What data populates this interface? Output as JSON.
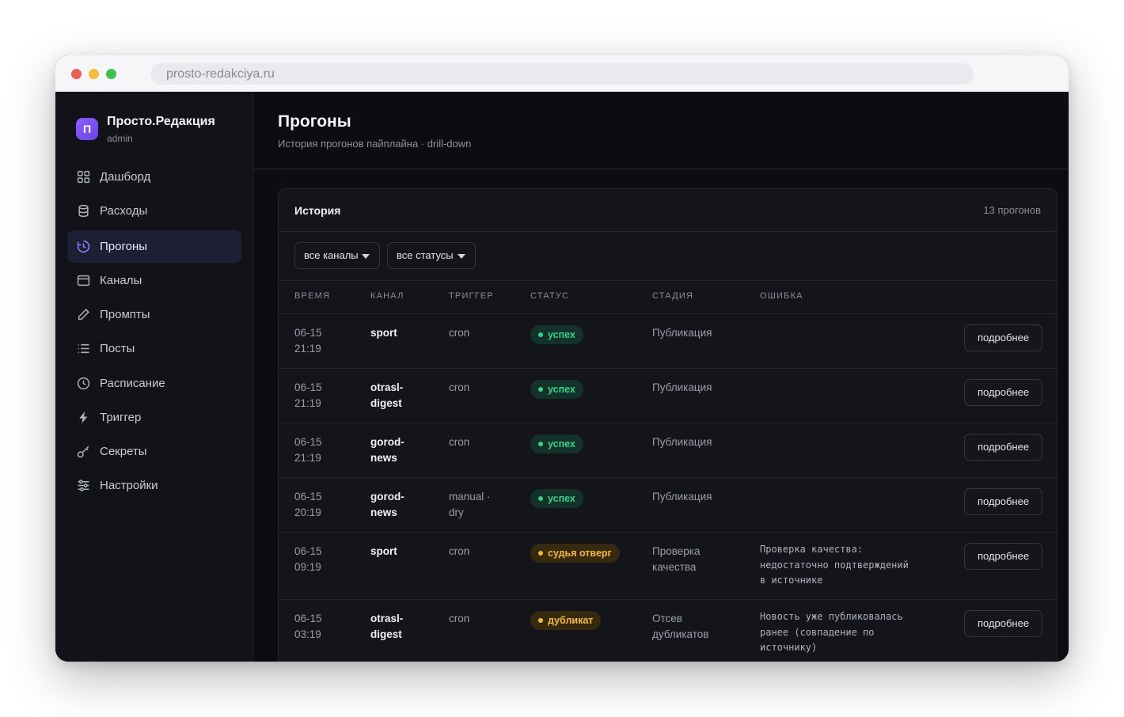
{
  "browser": {
    "url": "prosto-redakciya.ru"
  },
  "sidebar": {
    "brand_letter": "П",
    "brand_name": "Просто.Редакция",
    "brand_role": "admin",
    "items": [
      {
        "label": "Дашборд",
        "icon": "grid-icon"
      },
      {
        "label": "Расходы",
        "icon": "database-icon"
      },
      {
        "label": "Прогоны",
        "icon": "history-icon",
        "active": true
      },
      {
        "label": "Каналы",
        "icon": "window-icon"
      },
      {
        "label": "Промпты",
        "icon": "pencil-icon"
      },
      {
        "label": "Посты",
        "icon": "list-icon"
      },
      {
        "label": "Расписание",
        "icon": "clock-icon"
      },
      {
        "label": "Триггер",
        "icon": "lightning-icon"
      },
      {
        "label": "Секреты",
        "icon": "key-icon"
      },
      {
        "label": "Настройки",
        "icon": "sliders-icon"
      }
    ]
  },
  "header": {
    "title": "Прогоны",
    "subtitle": "История прогонов пайплайна · drill-down"
  },
  "card": {
    "title": "История",
    "count": "13 прогонов",
    "filters": {
      "channels": "все каналы",
      "statuses": "все статусы"
    },
    "columns": [
      "ВРЕМЯ",
      "КАНАЛ",
      "ТРИГГЕР",
      "СТАТУС",
      "СТАДИЯ",
      "ОШИБКА"
    ],
    "more_label": "подробнее",
    "rows": [
      {
        "time1": "06-15",
        "time2": "21:19",
        "chan1": "sport",
        "chan2": "",
        "trig1": "cron",
        "trig2": "",
        "status": "успех",
        "stage1": "Публикация",
        "stage2": "",
        "err": ""
      },
      {
        "time1": "06-15",
        "time2": "21:19",
        "chan1": "otrasl-",
        "chan2": "digest",
        "trig1": "cron",
        "trig2": "",
        "status": "успех",
        "stage1": "Публикация",
        "stage2": "",
        "err": ""
      },
      {
        "time1": "06-15",
        "time2": "21:19",
        "chan1": "gorod-",
        "chan2": "news",
        "trig1": "cron",
        "trig2": "",
        "status": "успех",
        "stage1": "Публикация",
        "stage2": "",
        "err": ""
      },
      {
        "time1": "06-15",
        "time2": "20:19",
        "chan1": "gorod-",
        "chan2": "news",
        "trig1": "manual ·",
        "trig2": "dry",
        "status": "успех",
        "stage1": "Публикация",
        "stage2": "",
        "err": ""
      },
      {
        "time1": "06-15",
        "time2": "09:19",
        "chan1": "sport",
        "chan2": "",
        "trig1": "cron",
        "trig2": "",
        "status": "судья отверг",
        "stage1": "Проверка",
        "stage2": "качества",
        "err1": "Проверка качества:",
        "err2": "недостаточно подтверждений",
        "err3": "в источнике"
      },
      {
        "time1": "06-15",
        "time2": "03:19",
        "chan1": "otrasl-",
        "chan2": "digest",
        "trig1": "cron",
        "trig2": "",
        "status": "дубликат",
        "stage1": "Отсев",
        "stage2": "дубликатов",
        "err1": "Новость уже публиковалась",
        "err2": "ранее (совпадение по",
        "err3": "источнику)"
      }
    ]
  },
  "colors": {
    "accent": "#8d5cff",
    "success": "#35d08b",
    "warning": "#f5b93a"
  }
}
